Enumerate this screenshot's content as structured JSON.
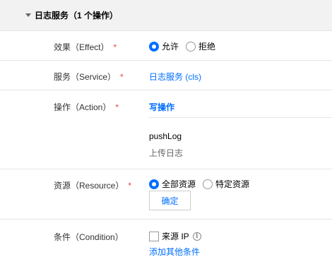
{
  "section": {
    "title": "日志服务（1 个操作）"
  },
  "effect": {
    "label": "效果（Effect）",
    "required_mark": "*",
    "options": [
      {
        "label": "允许",
        "checked": true
      },
      {
        "label": "拒绝",
        "checked": false
      }
    ]
  },
  "service": {
    "label": "服务（Service）",
    "required_mark": "*",
    "value": "日志服务 (cls)"
  },
  "action": {
    "label": "操作（Action）",
    "required_mark": "*",
    "value": "写操作",
    "items": [
      {
        "name": "pushLog",
        "desc": "上传日志"
      }
    ]
  },
  "resource": {
    "label": "资源（Resource）",
    "required_mark": "*",
    "options": [
      {
        "label": "全部资源",
        "checked": true
      },
      {
        "label": "特定资源",
        "checked": false
      }
    ],
    "confirm_label": "确定"
  },
  "condition": {
    "label": "条件（Condition）",
    "checkbox_label": "来源 IP",
    "info_glyph": "i",
    "add_link": "添加其他条件"
  },
  "colors": {
    "accent": "#006eff",
    "required": "#e54545",
    "header_bg": "#f2f2f2",
    "border": "#e5e5e5"
  }
}
